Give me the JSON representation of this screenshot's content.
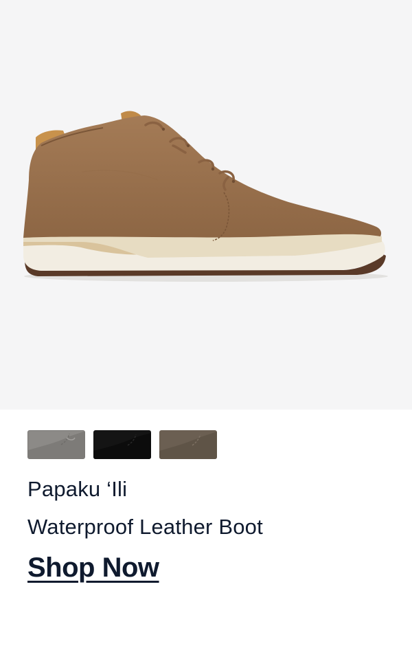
{
  "product": {
    "image_icon": "chukka-boot-image",
    "name_line1": "Papaku ‘Ili",
    "name_line2": "Waterproof Leather Boot",
    "cta_label": "Shop Now"
  },
  "swatches": [
    {
      "icon": "grey-colorway-swatch",
      "color": "#8c8a87"
    },
    {
      "icon": "black-colorway-swatch",
      "color": "#141414"
    },
    {
      "icon": "brown-colorway-swatch",
      "color": "#6b5f52"
    }
  ],
  "colors": {
    "background": "#f5f5f6",
    "text": "#0f1a2e",
    "boot_upper": "#9b7350",
    "boot_sole": "#f1ece0",
    "boot_midsole": "#d8c29c"
  }
}
